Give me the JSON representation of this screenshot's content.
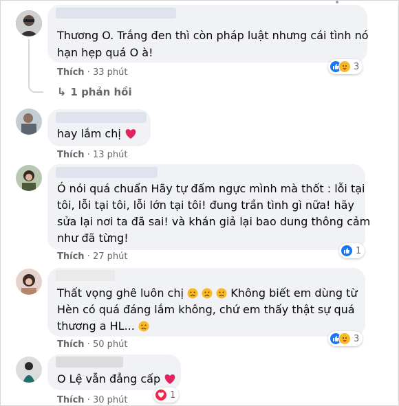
{
  "comments": [
    {
      "lines": [
        "Thương O. Trắng đen thì còn pháp luật nhưng cái tình nó",
        "hạn hẹp quá O à!"
      ],
      "like": "Thích",
      "time": "33 phút",
      "reaction_count": "3",
      "reaction_icons": [
        "like-icon",
        "care-icon"
      ]
    },
    {
      "lines": [
        "hay lắm chị"
      ],
      "like": "Thích",
      "time": "13 phút",
      "reaction_icons": [
        "heart-icon"
      ]
    },
    {
      "lines": [
        "Ó nói quá chuẩn Hãy tự đấm ngực mình mà thốt : lỗi tại",
        "tôi, lỗi tại tôi, lỗi lớn tại tôi! đung trần tình gì nữa! hãy",
        "sửa lại nơi ta đã sai! và khán giả lại bao dung thông cảm",
        "như đã từng!"
      ],
      "like": "Thích",
      "time": "27 phút",
      "reaction_count": "1",
      "reaction_icons": [
        "like-icon"
      ]
    },
    {
      "lines": [
        "Thất vọng ghê luôn chị",
        " Không biết em dùng từ",
        "Hèn có quá đáng lắm không, chứ em thấy thật sự quá",
        "thương a HL..."
      ],
      "like": "Thích",
      "time": "50 phút",
      "reaction_count": "3",
      "reaction_icons": [
        "like-icon",
        "care-icon",
        "sad-icon"
      ]
    },
    {
      "lines": [
        "O Lệ vẫn đẳng cấp"
      ],
      "like": "Thích",
      "time": "30 phút",
      "reaction_count": "1",
      "reaction_icons": [
        "love-icon",
        "heart-icon"
      ]
    }
  ],
  "reply": {
    "label": "1 phản hồi",
    "icon": "reply-arrow-icon"
  },
  "colors": {
    "bubble": "#f0f2f5",
    "meta": "#65676b",
    "like_blue": "#1877f2",
    "love_red": "#f02849",
    "care_yellow": "#f7b928"
  }
}
